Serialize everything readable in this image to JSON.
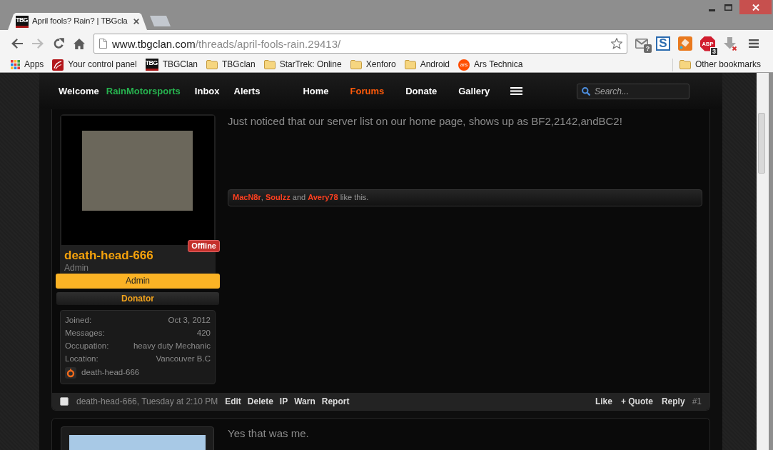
{
  "browser": {
    "tabs": [
      {
        "title": "April fools? Rain? | TBGcla",
        "favicon_text": "TBG",
        "selected": true
      }
    ],
    "nav_buttons": [
      {
        "kind": "back",
        "disabled": false
      },
      {
        "kind": "forward",
        "disabled": true
      },
      {
        "kind": "reload",
        "disabled": false
      },
      {
        "kind": "home",
        "disabled": false
      }
    ],
    "address": {
      "domain": "www.tbgclan.com",
      "path": "/threads/april-fools-rain.29413/"
    },
    "extensions": [
      {
        "kind": "mail",
        "badge": "?"
      },
      {
        "kind": "s",
        "label": "S"
      },
      {
        "kind": "tile"
      },
      {
        "kind": "abp",
        "label": "ABP",
        "badge": "3"
      },
      {
        "kind": "download"
      }
    ],
    "bookmarks": [
      {
        "kind": "apps",
        "label": "Apps"
      },
      {
        "kind": "panel",
        "label": "Your control panel"
      },
      {
        "kind": "logo",
        "label": "TBGClan",
        "icon_text": "TBG"
      },
      {
        "kind": "folder",
        "label": "TBGclan"
      },
      {
        "kind": "folder",
        "label": "StarTrek: Online"
      },
      {
        "kind": "folder",
        "label": "Xenforo"
      },
      {
        "kind": "folder",
        "label": "Android"
      },
      {
        "kind": "round-logo",
        "label": "Ars Technica",
        "icon_text": "ars"
      }
    ],
    "other_bookmarks": {
      "kind": "folder",
      "label": "Other bookmarks"
    }
  },
  "site_nav": {
    "welcome": "Welcome",
    "username": "RainMotorsports",
    "account_links": [
      "Inbox",
      "Alerts"
    ],
    "main_links": [
      {
        "label": "Home",
        "selected": false
      },
      {
        "label": "Forums",
        "selected": true
      },
      {
        "label": "Donate",
        "selected": false
      },
      {
        "label": "Gallery",
        "selected": false
      }
    ],
    "search": {
      "placeholder": "Search..."
    }
  },
  "posts": [
    {
      "avatar": {
        "kind": "poster"
      },
      "author": {
        "name": "death-head-666",
        "title": "Admin",
        "online": false,
        "status_label": "Offline",
        "banners": [
          {
            "kind": "primary",
            "label": "Admin"
          },
          {
            "kind": "secondary",
            "label": "Donator"
          }
        ],
        "stats": [
          {
            "label": "Joined:",
            "value": "Oct 3, 2012"
          },
          {
            "label": "Messages:",
            "value": "420"
          },
          {
            "label": "Occupation:",
            "value": "heavy duty Mechanic"
          },
          {
            "label": "Location:",
            "value": "Vancouver B.C"
          }
        ],
        "game_account": "death-head-666"
      },
      "message": "Just noticed that our server list on our home page, shows up as BF2,2142,andBC2!",
      "likes": {
        "users": [
          "MacN8r",
          "Soulzz",
          "Avery78"
        ],
        "separator": ",",
        "conjunction": "and",
        "suffix": "like this."
      },
      "selected": false,
      "byline": "death-head-666, Tuesday at 2:10 PM",
      "actions": [
        "Edit",
        "Delete",
        "IP",
        "Warn",
        "Report"
      ],
      "reactions": [
        "Like",
        "+ Quote",
        "Reply"
      ],
      "number": "#1"
    },
    {
      "avatar": {
        "kind": "cartoon"
      },
      "message": "Yes that was me."
    }
  ]
}
